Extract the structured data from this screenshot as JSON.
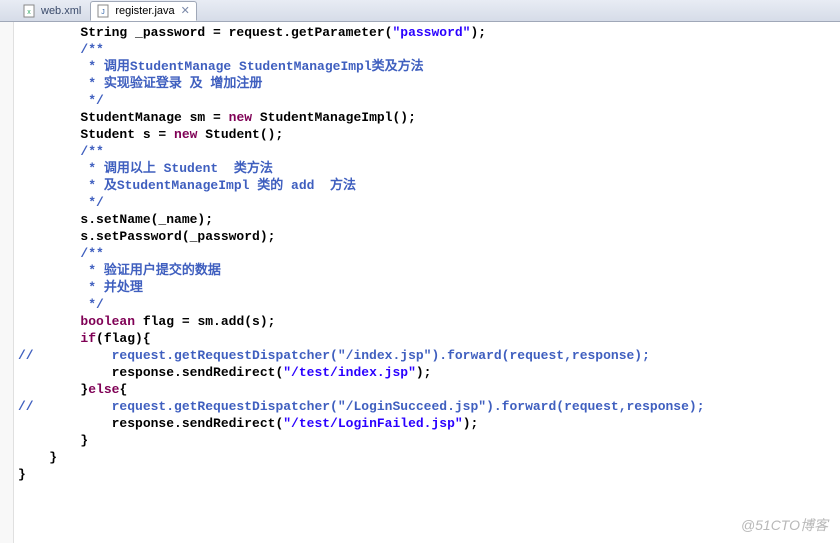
{
  "tabs": {
    "inactive": {
      "label": "web.xml"
    },
    "active": {
      "label": "register.java",
      "close": "✕"
    }
  },
  "code": {
    "l0a": "        String _password = request.getParameter(",
    "l0b": "\"password\"",
    "l0c": ");",
    "l1": "        /**",
    "l2": "         * 调用StudentManage StudentManageImpl类及方法",
    "l3": "         * 实现验证登录 及 增加注册",
    "l4": "         */",
    "l5a": "        StudentManage sm = ",
    "l5b": "new",
    "l5c": " StudentManageImpl();",
    "l6a": "        Student s = ",
    "l6b": "new",
    "l6c": " Student();",
    "l7": "        /**",
    "l8": "         * 调用以上 Student  类方法",
    "l9": "         * 及StudentManageImpl 类的 add  方法",
    "l10": "         */",
    "l11": "        s.setName(_name);",
    "l12": "        s.setPassword(_password);",
    "l13": "        /**",
    "l14": "         * 验证用户提交的数据",
    "l15": "         * 并处理",
    "l16": "         */",
    "l17a": "        ",
    "l17b": "boolean",
    "l17c": " flag = sm.add(s);",
    "l18a": "        ",
    "l18b": "if",
    "l18c": "(flag){",
    "l19a": "//          request.getRequestDispatcher(\"/index.jsp\").forward(request,response);",
    "l20a": "            response.sendRedirect(",
    "l20b": "\"/test/index.jsp\"",
    "l20c": ");",
    "l21a": "        }",
    "l21b": "else",
    "l21c": "{",
    "l22a": "//          request.getRequestDispatcher(\"/LoginSucceed.jsp\").forward(request,response);",
    "l23a": "            response.sendRedirect(",
    "l23b": "\"/test/LoginFailed.jsp\"",
    "l23c": ");",
    "l24": "        }",
    "l25": "",
    "l26": "    }",
    "l27": "",
    "l28": "}"
  },
  "watermark": "@51CTO博客"
}
